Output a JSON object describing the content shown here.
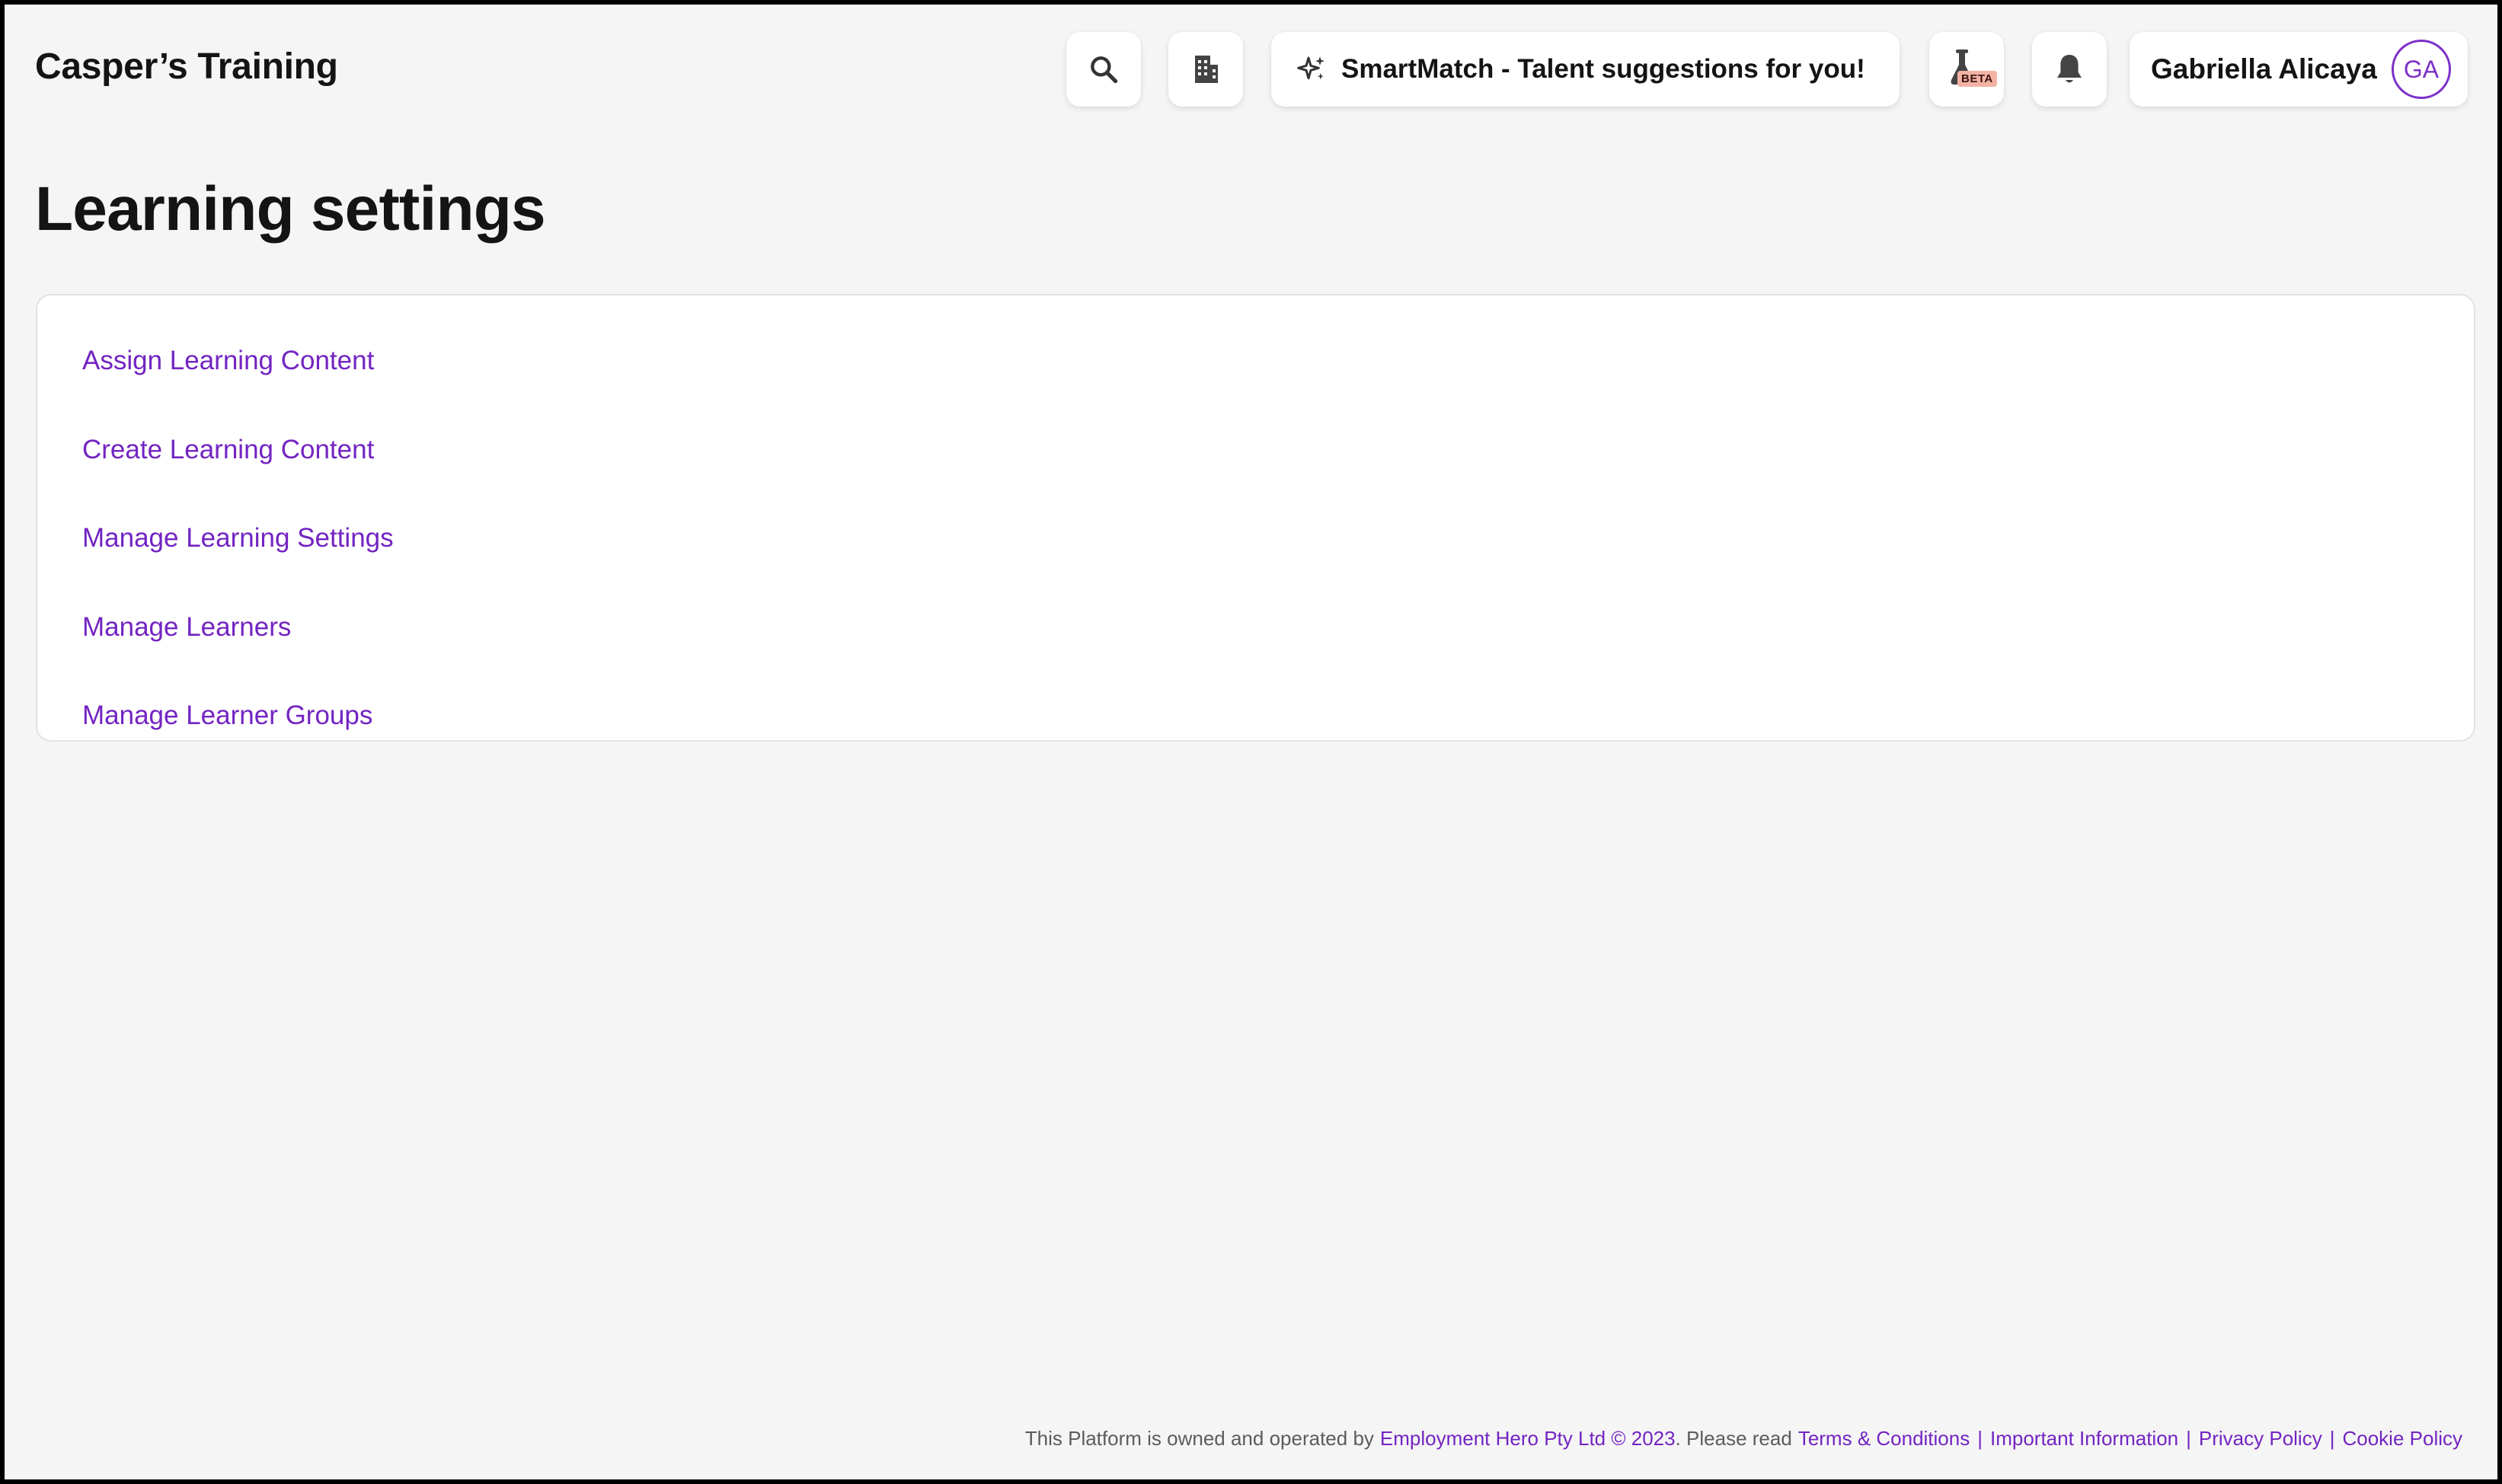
{
  "header": {
    "app_title": "Casper’s Training",
    "search_icon": "search-icon",
    "org_icon": "building-icon",
    "smartmatch_label": "SmartMatch - Talent suggestions for you!",
    "smartmatch_icon": "sparkle-icon",
    "beta_icon": "flask-icon",
    "beta_badge": "BETA",
    "notification_icon": "bell-icon",
    "user_name": "Gabriella Alicaya",
    "user_initials": "GA"
  },
  "main": {
    "title": "Learning settings",
    "links": [
      {
        "label": "Assign Learning Content"
      },
      {
        "label": "Create Learning Content"
      },
      {
        "label": "Manage Learning Settings"
      },
      {
        "label": "Manage Learners"
      },
      {
        "label": "Manage Learner Groups"
      }
    ]
  },
  "footer": {
    "prefix": "This Platform is owned and operated by",
    "company_link": "Employment Hero Pty Ltd © 2023",
    "please_read": ". Please read",
    "terms": "Terms & Conditions",
    "important": "Important Information",
    "privacy": "Privacy Policy",
    "cookie": "Cookie Policy",
    "separator": "|"
  },
  "colors": {
    "accent": "#7324c2",
    "background": "#f5f5f5",
    "text": "#141414"
  }
}
